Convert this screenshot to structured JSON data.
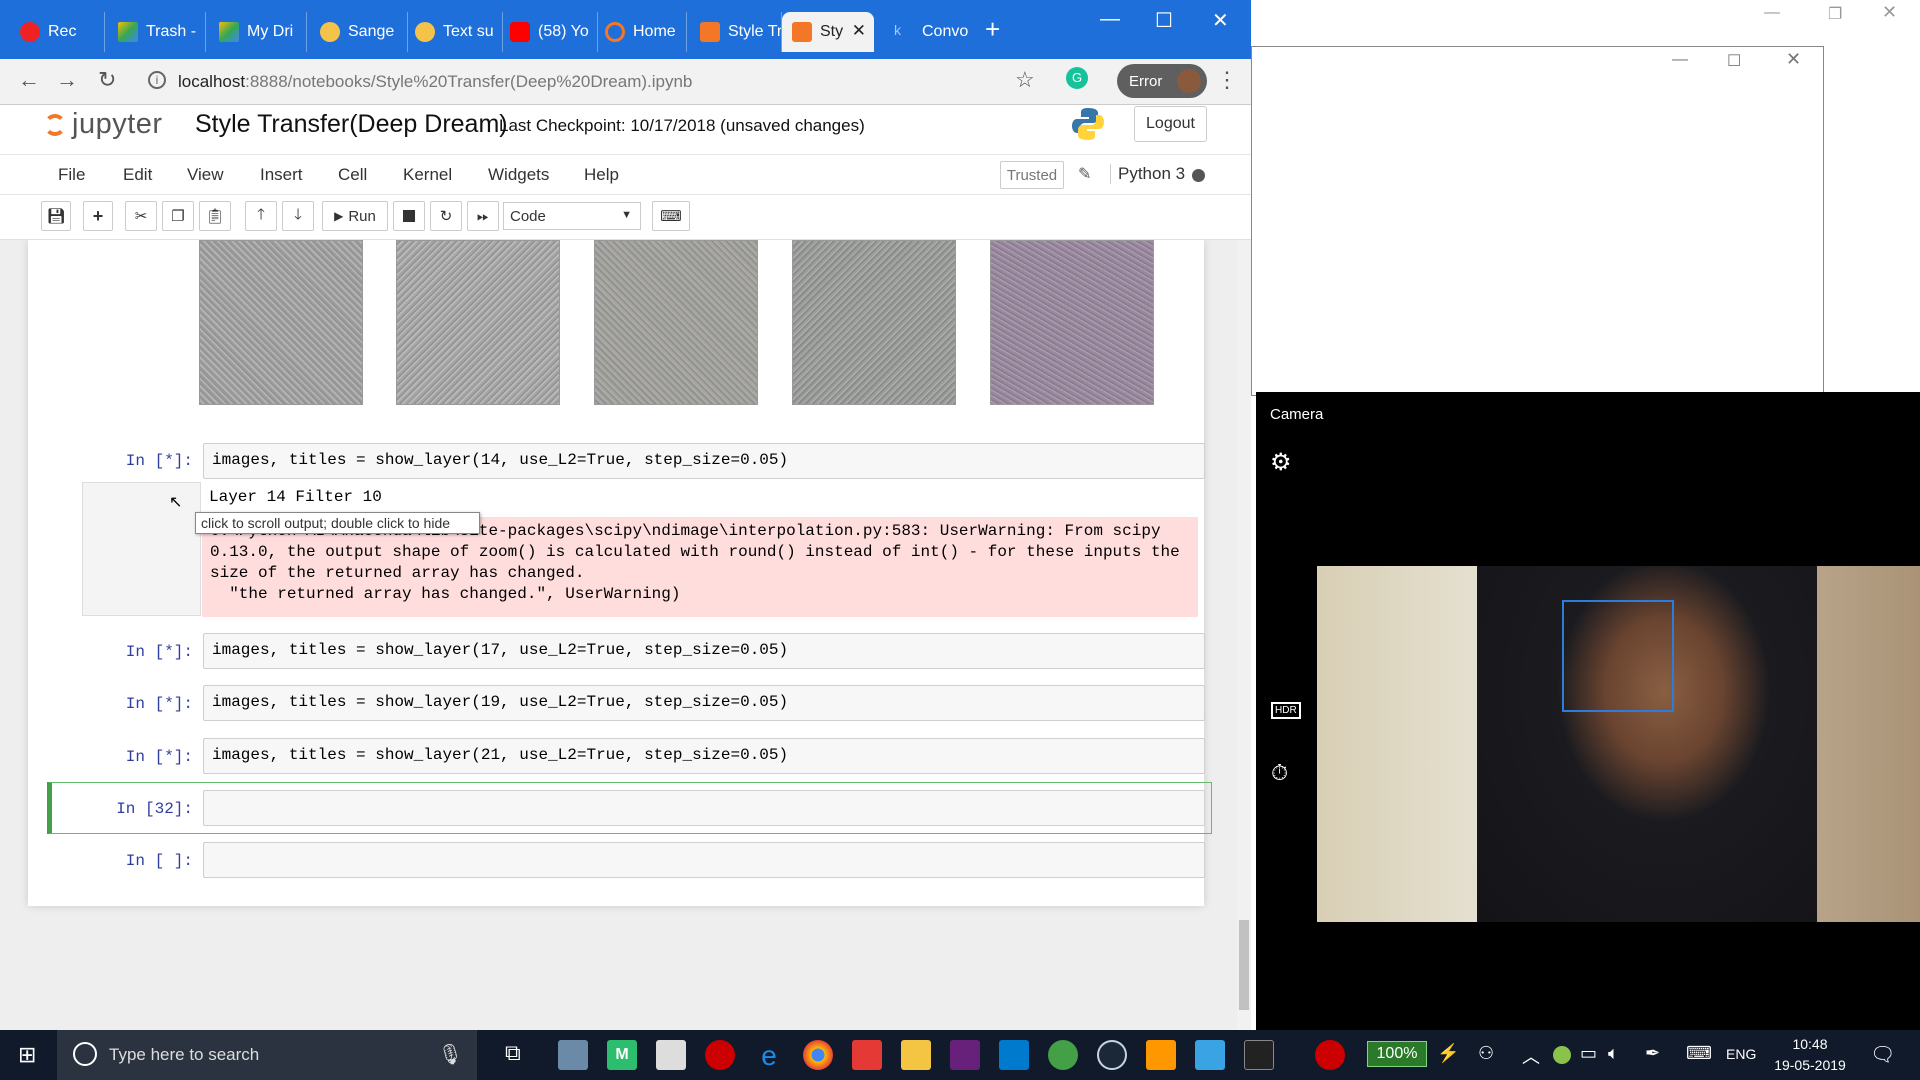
{
  "browser": {
    "tabs": [
      {
        "label": "Rec"
      },
      {
        "label": "Trash -"
      },
      {
        "label": "My Dri"
      },
      {
        "label": "Sange"
      },
      {
        "label": "Text su"
      },
      {
        "label": "(58) Yo"
      },
      {
        "label": "Home"
      },
      {
        "label": "Style Tr"
      },
      {
        "label": "Sty",
        "active": true
      },
      {
        "label": "Convo"
      }
    ],
    "url_host": "localhost",
    "url_path": ":8888/notebooks/Style%20Transfer(Deep%20Dream).ipynb",
    "error_label": "Error"
  },
  "jupyter": {
    "logo_text": "jupyter",
    "notebook_title": "Style Transfer(Deep Dream)",
    "checkpoint": "Last Checkpoint: 10/17/2018  (unsaved changes)",
    "logout_label": "Logout",
    "menus": [
      "File",
      "Edit",
      "View",
      "Insert",
      "Cell",
      "Kernel",
      "Widgets",
      "Help"
    ],
    "trusted_label": "Trusted",
    "kernel_name": "Python 3",
    "run_label": "Run",
    "cell_type": "Code"
  },
  "cells": {
    "c1_prompt": "In [*]:",
    "c1_code": "images, titles = show_layer(14, use_L2=True, step_size=0.05)",
    "c1_stdout": "Layer 14 Filter 10",
    "c1_stderr": "C:\\Python AI\\Anaconda\\lib\\site-packages\\scipy\\ndimage\\interpolation.py:583: UserWarning: From scipy\n0.13.0, the output shape of zoom() is calculated with round() instead of int() - for these inputs the\nsize of the returned array has changed.\n  \"the returned array has changed.\", UserWarning)",
    "tooltip": "click to scroll output; double click to hide",
    "c2_prompt": "In [*]:",
    "c2_code": "images, titles = show_layer(17, use_L2=True, step_size=0.05)",
    "c3_prompt": "In [*]:",
    "c3_code": "images, titles = show_layer(19, use_L2=True, step_size=0.05)",
    "c4_prompt": "In [*]:",
    "c4_code": "images, titles = show_layer(21, use_L2=True, step_size=0.05)",
    "c5_prompt": "In [32]:",
    "c6_prompt": "In [ ]:"
  },
  "camera": {
    "title": "Camera",
    "settings_icon": "gear-icon",
    "hdr_label": "HDR"
  },
  "taskbar": {
    "search_placeholder": "Type here to search",
    "battery": "100%",
    "language": "ENG",
    "time": "10:48",
    "date": "19-05-2019"
  },
  "colors": {
    "tabbar": "#1e6fd9",
    "jupyter_orange": "#f37726",
    "prompt_blue": "#303f9f",
    "stderr_bg": "#ffdddd",
    "selected_cell": "#42a047"
  }
}
